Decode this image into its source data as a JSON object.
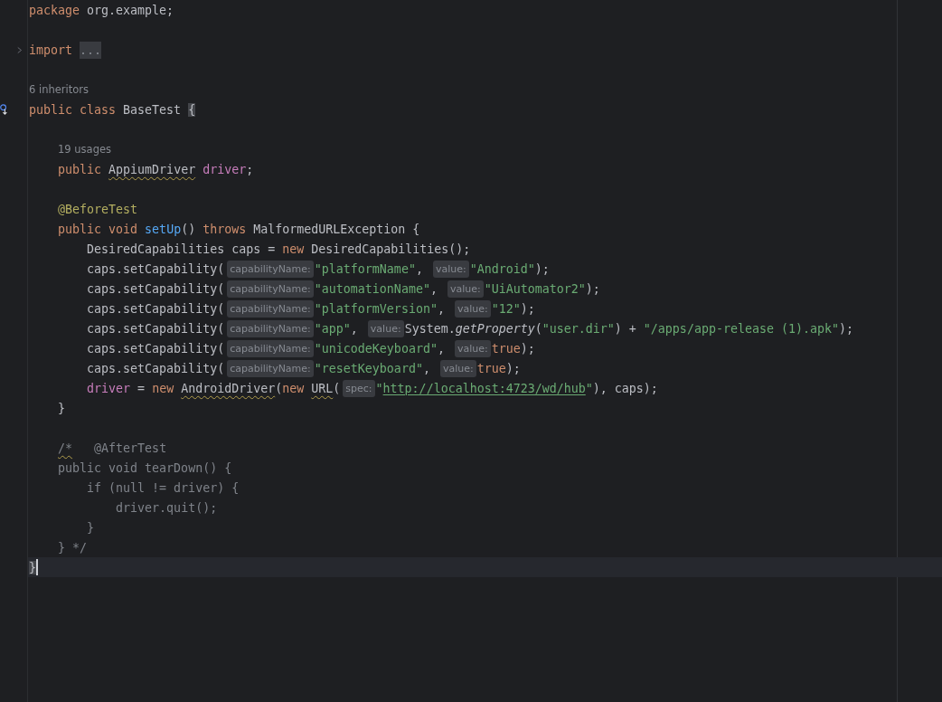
{
  "editor": {
    "lines": [
      {
        "kind": "code",
        "segments": [
          {
            "kind": "code",
            "tokens": [
              {
                "kind": "kw",
                "text": "package "
              },
              {
                "kind": "plain",
                "text": "org.example;"
              }
            ]
          }
        ]
      },
      {
        "kind": "blank"
      },
      {
        "kind": "code",
        "folded": true,
        "segments": [
          {
            "kind": "code",
            "tokens": [
              {
                "kind": "kw",
                "text": "import "
              },
              {
                "kind": "folded",
                "text": "..."
              }
            ]
          }
        ]
      },
      {
        "kind": "blank"
      },
      {
        "kind": "code",
        "segments": [
          {
            "kind": "note",
            "text": "6 inheritors"
          }
        ]
      },
      {
        "kind": "code",
        "has_implementations": true,
        "segments": [
          {
            "kind": "code",
            "tokens": [
              {
                "kind": "kw",
                "text": "public class "
              },
              {
                "kind": "plain",
                "text": "BaseTest "
              },
              {
                "kind": "brace",
                "text": "{"
              }
            ]
          }
        ]
      },
      {
        "kind": "blank"
      },
      {
        "kind": "code",
        "segments": [
          {
            "kind": "note",
            "text": "19 usages"
          }
        ]
      },
      {
        "kind": "code",
        "segments": [
          {
            "kind": "code",
            "tokens": [
              {
                "kind": "kw",
                "text": "    public "
              },
              {
                "kind": "warn",
                "text": "AppiumDriver"
              },
              {
                "kind": "field",
                "text": " driver"
              },
              {
                "kind": "plain",
                "text": ";"
              }
            ]
          }
        ]
      },
      {
        "kind": "blank"
      },
      {
        "kind": "code",
        "segments": [
          {
            "kind": "code",
            "tokens": [
              {
                "kind": "annot",
                "text": "    @BeforeTest"
              }
            ]
          }
        ]
      },
      {
        "kind": "code",
        "segments": [
          {
            "kind": "code",
            "tokens": [
              {
                "kind": "kw",
                "text": "    public void "
              },
              {
                "kind": "method",
                "text": "setUp"
              },
              {
                "kind": "plain",
                "text": "() "
              },
              {
                "kind": "kw",
                "text": "throws "
              },
              {
                "kind": "plain",
                "text": "MalformedURLException {"
              }
            ]
          }
        ]
      },
      {
        "kind": "code",
        "segments": [
          {
            "kind": "code",
            "tokens": [
              {
                "kind": "plain",
                "text": "        DesiredCapabilities caps = "
              },
              {
                "kind": "kw",
                "text": "new "
              },
              {
                "kind": "plain",
                "text": "DesiredCapabilities();"
              }
            ]
          }
        ]
      },
      {
        "kind": "code",
        "segments": [
          {
            "kind": "code",
            "tokens": [
              {
                "kind": "plain",
                "text": "        caps.setCapability("
              }
            ]
          },
          {
            "kind": "hint",
            "text": "capabilityName:"
          },
          {
            "kind": "code",
            "tokens": [
              {
                "kind": "str",
                "text": "\"platformName\""
              },
              {
                "kind": "plain",
                "text": ", "
              }
            ]
          },
          {
            "kind": "hint",
            "text": "value:"
          },
          {
            "kind": "code",
            "tokens": [
              {
                "kind": "str",
                "text": "\"Android\""
              },
              {
                "kind": "plain",
                "text": ");"
              }
            ]
          }
        ]
      },
      {
        "kind": "code",
        "segments": [
          {
            "kind": "code",
            "tokens": [
              {
                "kind": "plain",
                "text": "        caps.setCapability("
              }
            ]
          },
          {
            "kind": "hint",
            "text": "capabilityName:"
          },
          {
            "kind": "code",
            "tokens": [
              {
                "kind": "str",
                "text": "\"automationName\""
              },
              {
                "kind": "plain",
                "text": ", "
              }
            ]
          },
          {
            "kind": "hint",
            "text": "value:"
          },
          {
            "kind": "code",
            "tokens": [
              {
                "kind": "str",
                "text": "\"UiAutomator2\""
              },
              {
                "kind": "plain",
                "text": ");"
              }
            ]
          }
        ]
      },
      {
        "kind": "code",
        "segments": [
          {
            "kind": "code",
            "tokens": [
              {
                "kind": "plain",
                "text": "        caps.setCapability("
              }
            ]
          },
          {
            "kind": "hint",
            "text": "capabilityName:"
          },
          {
            "kind": "code",
            "tokens": [
              {
                "kind": "str",
                "text": "\"platformVersion\""
              },
              {
                "kind": "plain",
                "text": ", "
              }
            ]
          },
          {
            "kind": "hint",
            "text": "value:"
          },
          {
            "kind": "code",
            "tokens": [
              {
                "kind": "str",
                "text": "\"12\""
              },
              {
                "kind": "plain",
                "text": ");"
              }
            ]
          }
        ]
      },
      {
        "kind": "code",
        "segments": [
          {
            "kind": "code",
            "tokens": [
              {
                "kind": "plain",
                "text": "        caps.setCapability("
              }
            ]
          },
          {
            "kind": "hint",
            "text": "capabilityName:"
          },
          {
            "kind": "code",
            "tokens": [
              {
                "kind": "str",
                "text": "\"app\""
              },
              {
                "kind": "plain",
                "text": ", "
              }
            ]
          },
          {
            "kind": "hint",
            "text": "value:"
          },
          {
            "kind": "code",
            "tokens": [
              {
                "kind": "plain",
                "text": "System."
              },
              {
                "kind": "static",
                "text": "getProperty"
              },
              {
                "kind": "plain",
                "text": "("
              },
              {
                "kind": "str",
                "text": "\"user.dir\""
              },
              {
                "kind": "plain",
                "text": ") + "
              },
              {
                "kind": "str",
                "text": "\"/apps/app-release (1).apk\""
              },
              {
                "kind": "plain",
                "text": ");"
              }
            ]
          }
        ]
      },
      {
        "kind": "code",
        "segments": [
          {
            "kind": "code",
            "tokens": [
              {
                "kind": "plain",
                "text": "        caps.setCapability("
              }
            ]
          },
          {
            "kind": "hint",
            "text": "capabilityName:"
          },
          {
            "kind": "code",
            "tokens": [
              {
                "kind": "str",
                "text": "\"unicodeKeyboard\""
              },
              {
                "kind": "plain",
                "text": ", "
              }
            ]
          },
          {
            "kind": "hint",
            "text": "value:"
          },
          {
            "kind": "code",
            "tokens": [
              {
                "kind": "kw",
                "text": "true"
              },
              {
                "kind": "plain",
                "text": ");"
              }
            ]
          }
        ]
      },
      {
        "kind": "code",
        "segments": [
          {
            "kind": "code",
            "tokens": [
              {
                "kind": "plain",
                "text": "        caps.setCapability("
              }
            ]
          },
          {
            "kind": "hint",
            "text": "capabilityName:"
          },
          {
            "kind": "code",
            "tokens": [
              {
                "kind": "str",
                "text": "\"resetKeyboard\""
              },
              {
                "kind": "plain",
                "text": ", "
              }
            ]
          },
          {
            "kind": "hint",
            "text": "value:"
          },
          {
            "kind": "code",
            "tokens": [
              {
                "kind": "kw",
                "text": "true"
              },
              {
                "kind": "plain",
                "text": ");"
              }
            ]
          }
        ]
      },
      {
        "kind": "code",
        "segments": [
          {
            "kind": "code",
            "tokens": [
              {
                "kind": "field",
                "text": "        driver"
              },
              {
                "kind": "plain",
                "text": " = "
              },
              {
                "kind": "kw",
                "text": "new "
              },
              {
                "kind": "warn",
                "text": "AndroidDriver"
              },
              {
                "kind": "plain",
                "text": "("
              },
              {
                "kind": "kw",
                "text": "new "
              },
              {
                "kind": "warn",
                "text": "URL"
              },
              {
                "kind": "plain",
                "text": "("
              }
            ]
          },
          {
            "kind": "hint",
            "text": "spec:"
          },
          {
            "kind": "code",
            "tokens": [
              {
                "kind": "str",
                "text": "\""
              },
              {
                "kind": "link",
                "text": "http://localhost:4723/wd/hub"
              },
              {
                "kind": "str",
                "text": "\""
              },
              {
                "kind": "plain",
                "text": "), caps);"
              }
            ]
          }
        ]
      },
      {
        "kind": "code",
        "segments": [
          {
            "kind": "code",
            "tokens": [
              {
                "kind": "plain",
                "text": "    }"
              }
            ]
          }
        ]
      },
      {
        "kind": "blank"
      },
      {
        "kind": "code",
        "segments": [
          {
            "kind": "code",
            "tokens": [
              {
                "kind": "comment-warn",
                "text": "    /*"
              },
              {
                "kind": "comment",
                "text": "   @AfterTest"
              }
            ]
          }
        ]
      },
      {
        "kind": "code",
        "segments": [
          {
            "kind": "code",
            "tokens": [
              {
                "kind": "comment",
                "text": "    public void tearDown() {"
              }
            ]
          }
        ]
      },
      {
        "kind": "code",
        "segments": [
          {
            "kind": "code",
            "tokens": [
              {
                "kind": "comment",
                "text": "        if (null != driver) {"
              }
            ]
          }
        ]
      },
      {
        "kind": "code",
        "segments": [
          {
            "kind": "code",
            "tokens": [
              {
                "kind": "comment",
                "text": "            driver.quit();"
              }
            ]
          }
        ]
      },
      {
        "kind": "code",
        "segments": [
          {
            "kind": "code",
            "tokens": [
              {
                "kind": "comment",
                "text": "        }"
              }
            ]
          }
        ]
      },
      {
        "kind": "code",
        "segments": [
          {
            "kind": "code",
            "tokens": [
              {
                "kind": "comment",
                "text": "    } */"
              }
            ]
          }
        ]
      },
      {
        "kind": "code",
        "current": true,
        "segments": [
          {
            "kind": "code",
            "tokens": [
              {
                "kind": "brace",
                "text": "}"
              }
            ]
          }
        ]
      }
    ]
  }
}
